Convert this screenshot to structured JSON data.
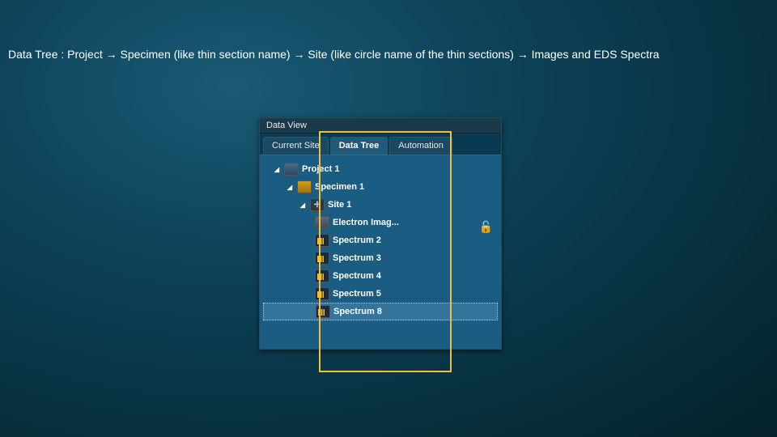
{
  "caption": "Data Tree : Project → Specimen (like thin section name) → Site (like circle name of the thin sections) → Images and EDS Spectra",
  "panel": {
    "title": "Data View",
    "tabs": [
      {
        "label": "Current Site",
        "active": false
      },
      {
        "label": "Data Tree",
        "active": true
      },
      {
        "label": "Automation",
        "active": false
      }
    ]
  },
  "tree": {
    "project": "Project 1",
    "specimen": "Specimen 1",
    "site": "Site 1",
    "items": [
      {
        "label": "Electron Imag...",
        "type": "image"
      },
      {
        "label": "Spectrum 2",
        "type": "spectrum"
      },
      {
        "label": "Spectrum 3",
        "type": "spectrum"
      },
      {
        "label": "Spectrum 4",
        "type": "spectrum"
      },
      {
        "label": "Spectrum 5",
        "type": "spectrum"
      },
      {
        "label": "Spectrum 8",
        "type": "spectrum",
        "selected": true
      }
    ]
  }
}
